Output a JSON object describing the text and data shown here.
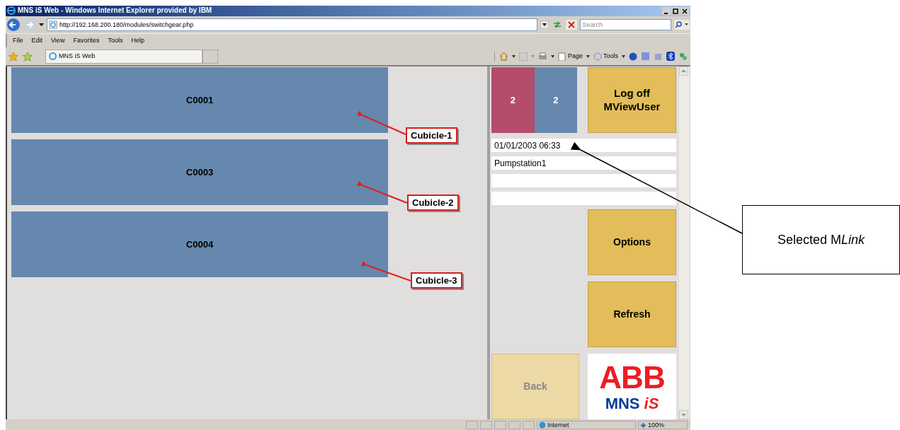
{
  "window": {
    "title": "MNS iS Web - Windows Internet Explorer provided by IBM",
    "address": "http://192.168.200.180/modules/switchgear.php",
    "search": {
      "placeholder": "Search"
    },
    "menu": [
      "File",
      "Edit",
      "View",
      "Favorites",
      "Tools",
      "Help"
    ],
    "tabs": [
      {
        "label": "MNS iS Web",
        "selected": true
      }
    ],
    "command_bar": [
      "Page",
      "Tools"
    ]
  },
  "app": {
    "cubicles": [
      {
        "label": "C0001"
      },
      {
        "label": "C0003"
      },
      {
        "label": "C0004"
      }
    ],
    "counters": [
      {
        "value": "2",
        "color": "#b44c6c"
      },
      {
        "value": "2",
        "color": "#6688ae"
      }
    ],
    "logoff_button": "Log off MViewUser",
    "info_fields": [
      {
        "value": "01/01/2003 06:33"
      },
      {
        "value": "Pumpstation1"
      }
    ],
    "buttons": [
      {
        "label": "Options",
        "disabled": false
      },
      {
        "label": "Refresh",
        "disabled": false
      },
      {
        "label": "Back",
        "disabled": true
      }
    ],
    "logo": {
      "mark": "ABB",
      "product": "MNS",
      "suffix": "iS"
    }
  },
  "status_bar": {
    "zone": "Internet",
    "zoom": "100%"
  },
  "annotations": {
    "callouts": [
      "Cubicle-1",
      "Cubicle-2",
      "Cubicle-3"
    ],
    "note": [
      {
        "text": "Selected M",
        "italic": false
      },
      {
        "text": "Link",
        "italic": true
      }
    ]
  }
}
